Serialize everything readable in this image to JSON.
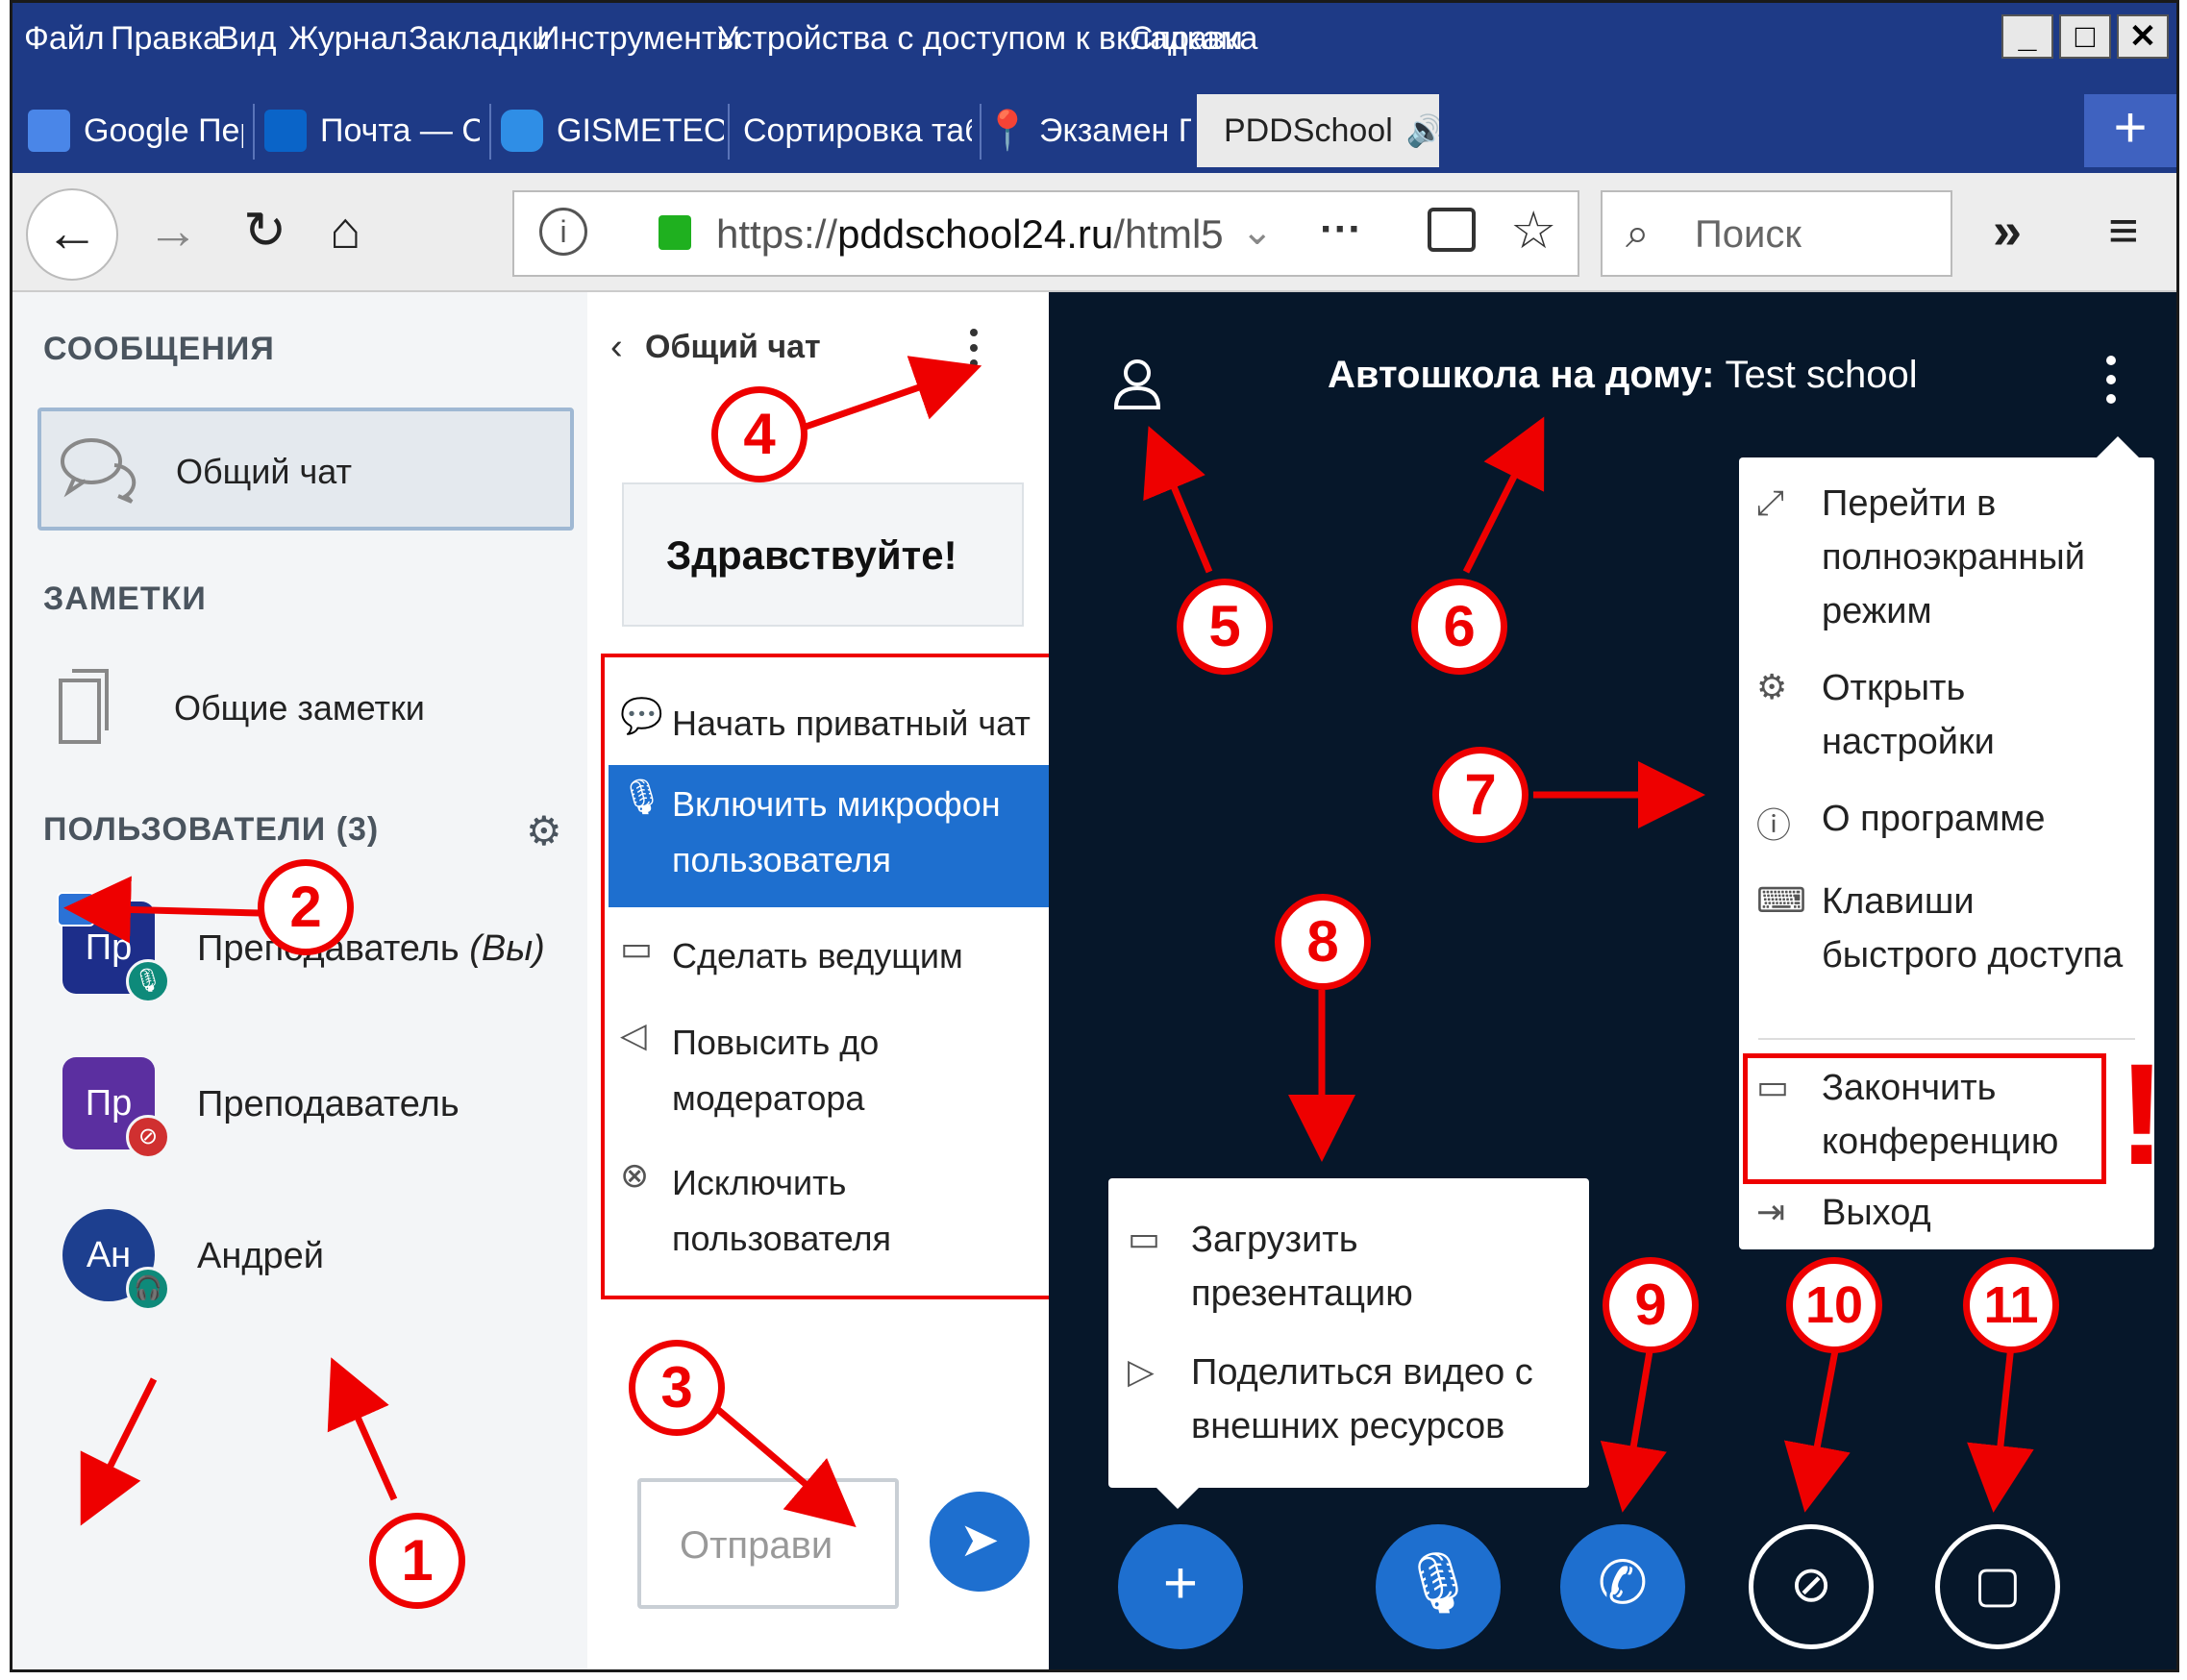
{
  "menubar": {
    "items": [
      "Файл",
      "Правка",
      "Вид",
      "Журнал",
      "Закладки",
      "Инструменты",
      "Устройства с доступом к вкладкам",
      "Справка"
    ],
    "window_buttons": [
      "_",
      "□",
      "✕"
    ]
  },
  "tabs": [
    {
      "label": "Google Перево",
      "icon": "google-translate-icon"
    },
    {
      "label": "Почта — Снет",
      "icon": "outlook-icon"
    },
    {
      "label": "GISMETEO: По",
      "icon": "gismeteo-icon"
    },
    {
      "label": "Сортировка табли",
      "icon": ""
    },
    {
      "label": "Экзамен ГИБД",
      "icon": "pin-icon"
    },
    {
      "label": "PDDSchool",
      "icon": "speaker-icon",
      "active": true
    }
  ],
  "newtab_label": "+",
  "nav": {
    "url_prefix": "https://",
    "url_host": "pddschool24.ru",
    "url_rest": "/html5",
    "search_placeholder": "Поиск"
  },
  "left_panel": {
    "messages_header": "СООБЩЕНИЯ",
    "public_chat": "Общий чат",
    "notes_header": "ЗАМЕТКИ",
    "shared_notes": "Общие заметки",
    "users_header": "ПОЛЬЗОВАТЕЛИ (3)",
    "users": [
      {
        "initials": "Пр",
        "name": "Преподаватель",
        "suffix": "(Вы)",
        "avatar_color": "#1d2e8a",
        "badge_color": "#0e8a7a",
        "badge": "mic"
      },
      {
        "initials": "Пр",
        "name": "Преподаватель",
        "suffix": "",
        "avatar_color": "#5b2fa0",
        "badge_color": "#d03030",
        "badge": "mic-off"
      },
      {
        "initials": "Ан",
        "name": "Андрей",
        "suffix": "",
        "avatar_color": "#1d3f8f",
        "badge_color": "#0e8a7a",
        "badge": "headset"
      }
    ]
  },
  "chat_panel": {
    "back_title": "Общий чат",
    "greeting": "Здравствуйте!",
    "context_menu": [
      {
        "icon": "chat-bubble-icon",
        "lines": [
          "Начать приватный чат"
        ]
      },
      {
        "icon": "microphone-icon",
        "lines": [
          "Включить микрофон",
          "пользователя"
        ],
        "highlight": true
      },
      {
        "icon": "presentation-icon",
        "lines": [
          "Сделать ведущим"
        ]
      },
      {
        "icon": "megaphone-icon",
        "lines": [
          "Повысить до",
          "модератора"
        ]
      },
      {
        "icon": "remove-icon",
        "lines": [
          "Исключить",
          "пользователя"
        ]
      }
    ],
    "send_placeholder": "Отправи"
  },
  "meeting": {
    "title_bold": "Автошкола на дому:",
    "title_rest": " Test school",
    "options_menu": [
      {
        "icon": "fullscreen-icon",
        "lines": [
          "Перейти в",
          "полноэкранный",
          "режим"
        ]
      },
      {
        "icon": "settings-icon",
        "lines": [
          "Открыть",
          "настройки"
        ]
      },
      {
        "icon": "info-icon",
        "lines": [
          "О программе"
        ]
      },
      {
        "icon": "keyboard-icon",
        "lines": [
          "Клавиши",
          "быстрого доступа"
        ]
      },
      {
        "icon": "end-meeting-icon",
        "lines": [
          "Закончить",
          "конференцию"
        ]
      },
      {
        "icon": "logout-icon",
        "lines": [
          "Выход"
        ]
      }
    ],
    "exclaim": "!",
    "actions_menu": [
      {
        "icon": "presentation-icon",
        "lines": [
          "Загрузить",
          "презентацию"
        ]
      },
      {
        "icon": "video-icon",
        "lines": [
          "Поделиться видео с",
          "внешних ресурсов"
        ]
      }
    ]
  },
  "annotations": [
    "1",
    "2",
    "3",
    "4",
    "5",
    "6",
    "7",
    "8",
    "9",
    "10",
    "11"
  ],
  "colors": {
    "accent": "#1e6fcf",
    "annotation": "#e00000",
    "dark_bg": "#06172a",
    "browser_blue": "#1e3a86"
  }
}
